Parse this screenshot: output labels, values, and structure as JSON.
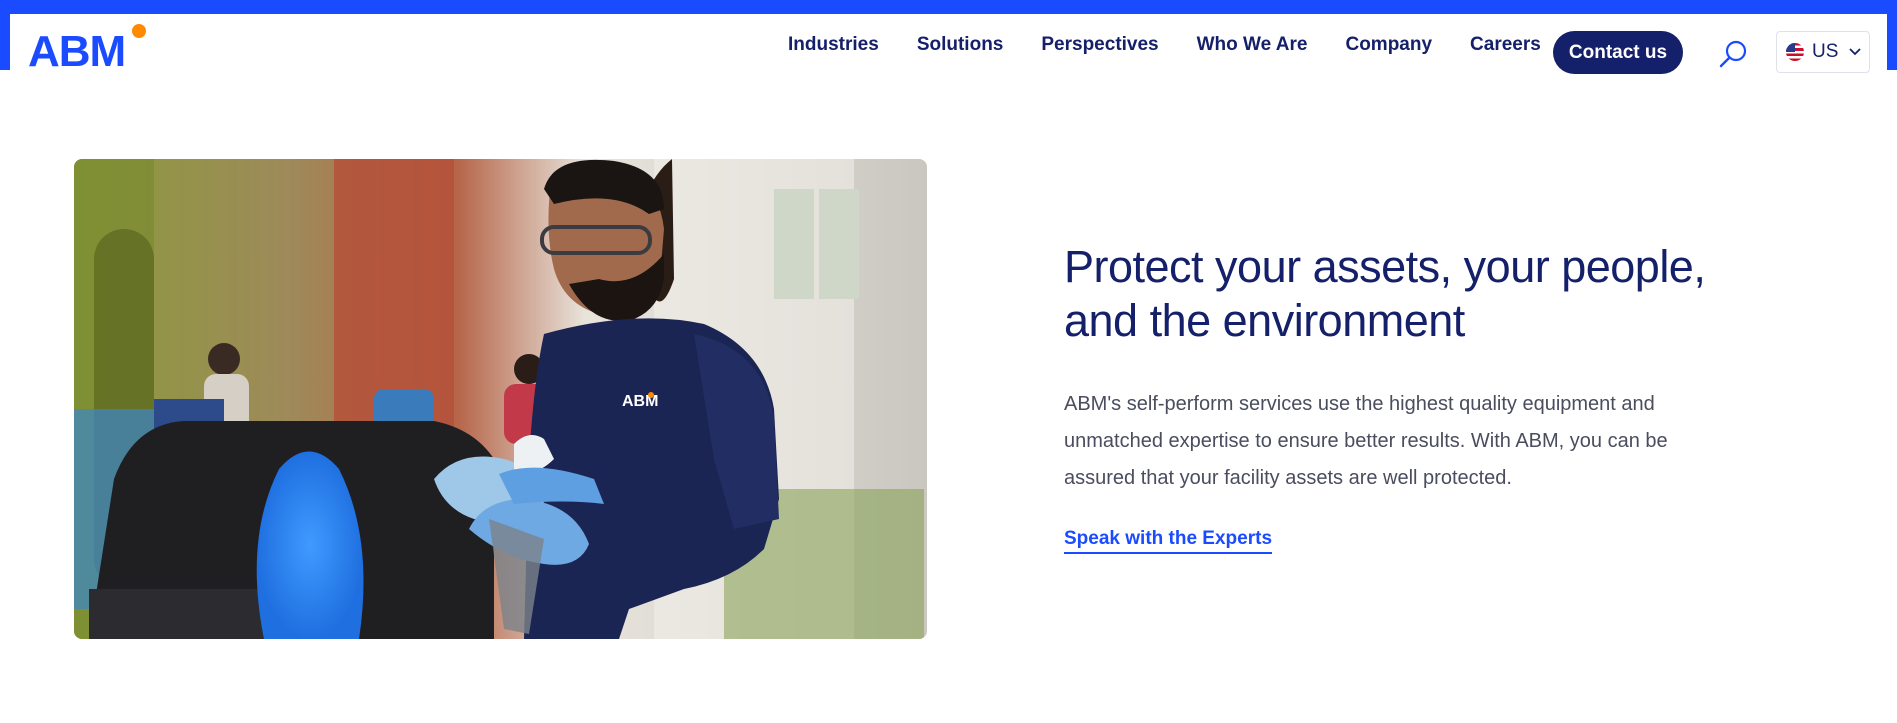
{
  "brand": {
    "logo_text": "ABM",
    "accent": "#1a4bff",
    "navy": "#15206a",
    "dot": "#ff8a00"
  },
  "nav": {
    "items": [
      "Industries",
      "Solutions",
      "Perspectives",
      "Who We Are",
      "Company",
      "Careers"
    ],
    "contact_label": "Contact us",
    "search_icon": "search-icon",
    "locale": {
      "flag_icon": "us-flag-icon",
      "label": "US",
      "chevron_icon": "chevron-down-icon"
    }
  },
  "hero": {
    "image_alt": "ABM worker in navy polo wearing safety glasses and blue gloves cleaning a janitorial cart",
    "polo_logo": "ABM",
    "headline": "Protect your assets, your people, and the environment",
    "body": "ABM's self-perform services use the highest quality equipment and unmatched expertise to ensure better results. With ABM, you can be assured that your facility assets are well protected.",
    "cta_label": "Speak with the Experts"
  }
}
